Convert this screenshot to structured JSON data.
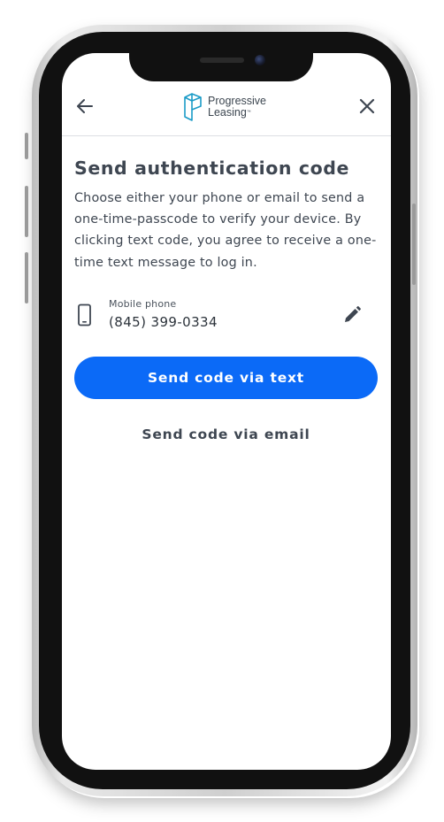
{
  "header": {
    "back_icon": "arrow-left-icon",
    "close_icon": "close-icon",
    "logo": {
      "line1": "Progressive",
      "line2": "Leasing",
      "trademark": "™"
    }
  },
  "main": {
    "title": "Send authentication code",
    "description": "Choose either your phone or email to send a one-time-passcode to verify your device. By clicking text code, you agree to receive a one-time text message to log in.",
    "phone": {
      "icon": "mobile-phone-icon",
      "label": "Mobile phone",
      "value": "(845) 399-0334",
      "edit_icon": "pencil-icon"
    },
    "primary_button": "Send code via text",
    "secondary_button": "Send code via email"
  },
  "colors": {
    "primary": "#0b6af7",
    "text": "#3e4651",
    "logo_accent": "#1a9bc7"
  }
}
